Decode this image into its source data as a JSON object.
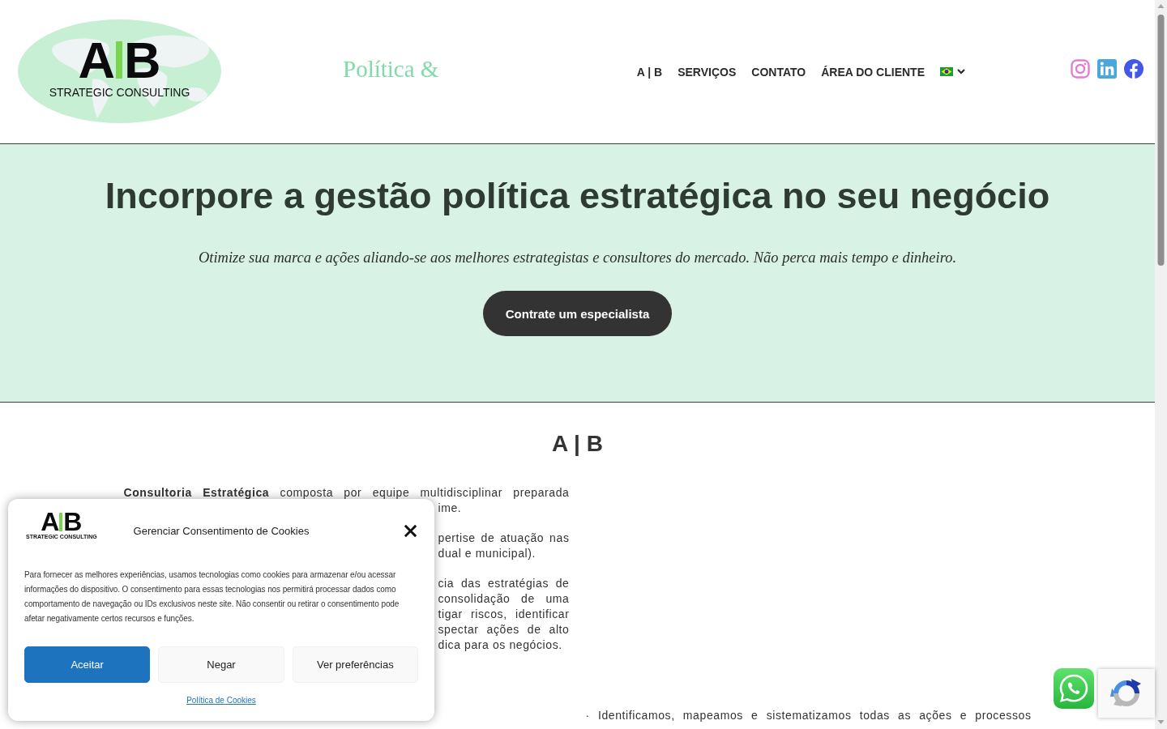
{
  "header": {
    "logo": {
      "letters": [
        "A",
        "B"
      ],
      "tagline": "STRATEGIC CONSULTING"
    },
    "site_title": "Política &",
    "nav": [
      "A | B",
      "SERVIÇOS",
      "CONTATO",
      "ÁREA DO CLIENTE"
    ]
  },
  "hero": {
    "headline": "Incorpore a gestão política estratégica no seu negócio",
    "subtitle": "Otimize sua marca e ações aliando-se aos melhores estrategistas e consultores do mercado. Não perca mais tempo e dinheiro.",
    "button": "Contrate um especialista"
  },
  "about": {
    "heading": "A | B",
    "left_column": [
      {
        "lines": [
          {
            "kind": "full",
            "text": "**Consultoria Estratégica** composta por equipe multidisciplinar preparada"
          },
          {
            "kind": "end",
            "text": "ime."
          }
        ]
      },
      {
        "lines": [
          {
            "kind": "clipped",
            "text": "pertise de atuação nas"
          },
          {
            "kind": "end",
            "text": "dual e municipal)."
          }
        ]
      },
      {
        "lines": [
          {
            "kind": "clipped",
            "text": "cia das estratégias de"
          },
          {
            "kind": "clipped",
            "text": "consolidação de uma"
          },
          {
            "kind": "clipped",
            "text": "tigar riscos, identificar"
          },
          {
            "kind": "clipped",
            "text": "spectar ações de alto"
          },
          {
            "kind": "end",
            "text": "dica para os negócios."
          }
        ]
      }
    ],
    "right_column": [
      {
        "kind": "full",
        "text": "· Identificamos, mapeamos e sistematizamos todas as ações e processos"
      }
    ]
  },
  "cookie_dialog": {
    "logo": {
      "letters": [
        "A",
        "B"
      ],
      "tagline": "STRATEGIC CONSULTING"
    },
    "title": "Gerenciar Consentimento de Cookies",
    "text": "Para fornecer as melhores experiências, usamos tecnologias como cookies para armazenar e/ou acessar informações do dispositivo. O consentimento para essas tecnologias nos permitirá processar dados como comportamento de navegação ou IDs exclusivos neste site. Não consentir ou retirar o consentimento pode afetar negativamente certos recursos e funções.",
    "buttons": [
      {
        "label": "Aceitar",
        "kind": "primary"
      },
      {
        "label": "Negar",
        "kind": "secondary"
      },
      {
        "label": "Ver preferências",
        "kind": "secondary"
      }
    ],
    "link": "Política de Cookies"
  }
}
